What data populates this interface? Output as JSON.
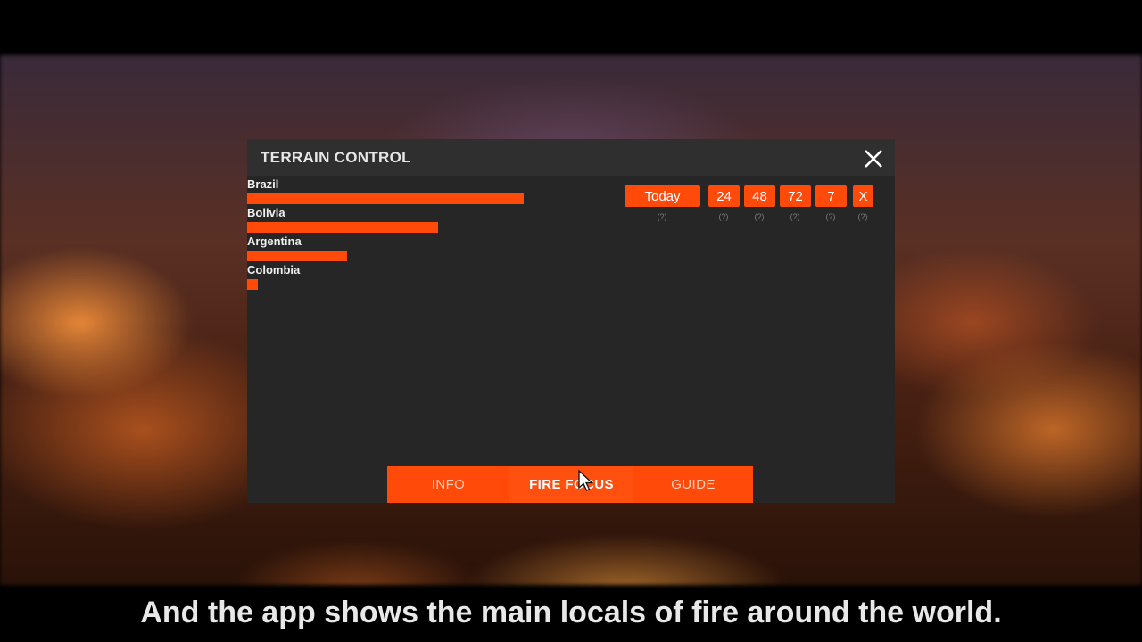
{
  "window": {
    "title": "TERRAIN CONTROL",
    "close_icon": "close-icon"
  },
  "countries": [
    {
      "name": "Brazil",
      "level": 1.0
    },
    {
      "name": "Bolivia",
      "level": 0.69
    },
    {
      "name": "Argentina",
      "level": 0.36
    },
    {
      "name": "Colombia",
      "level": 0.04
    }
  ],
  "filters": [
    {
      "label": "Today",
      "help": "(?)"
    },
    {
      "label": "24",
      "help": "(?)"
    },
    {
      "label": "48",
      "help": "(?)"
    },
    {
      "label": "72",
      "help": "(?)"
    },
    {
      "label": "7",
      "help": "(?)"
    },
    {
      "label": "X",
      "help": "(?)"
    }
  ],
  "tabs": {
    "info": "INFO",
    "fire_focus": "FIRE FOCUS",
    "guide": "GUIDE"
  },
  "caption": "And the app shows the main locals of fire around the world.",
  "colors": {
    "accent": "#ff4a0a",
    "panel_bg": "#262626",
    "header_bg": "#2f2f2f"
  }
}
